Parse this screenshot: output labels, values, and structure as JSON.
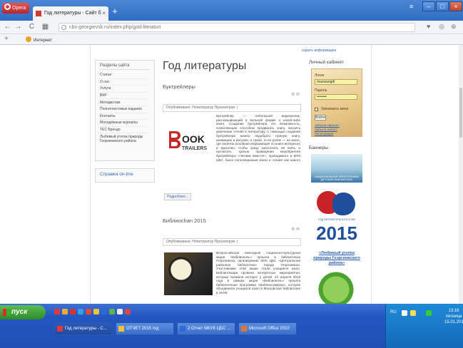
{
  "browser": {
    "menu_label": "Opera",
    "tab_title": "Год литературы - Сайт б",
    "url": "cbs-georgievsk.ru/index.php/god-literaturi",
    "bookmark_label": "Интернет"
  },
  "site": {
    "top_link": "скрыть информацию",
    "sidebar": {
      "title": "Разделы сайта",
      "items": [
        "Статьи",
        "О нас",
        "Услуги",
        "ВКР",
        "Методистам",
        "Полнотекстовые издания",
        "Контакты",
        "Молодёжные журналы",
        "ТЕС Брендо",
        "Любимый уголок природы Георгиевского района"
      ]
    },
    "online_label": "Справка on-line",
    "page_title": "Год литературы",
    "articles": [
      {
        "title": "Буктрейлеры",
        "category": "Опубликовано: Нолитератур  Просмотров: |",
        "logo_top": "OOK",
        "logo_bottom": "TRAILERS",
        "text": "Буктрейлер — небольшой видеоролик, рассказывающий в вольной форме о какой-либо книге. Создание буктрейлера это возможность, позволяющая способом продвигать книгу, вносить увлечение чтения в литературу. С помощью создания буктрейлера можно подобрать нужную книгу, анимацию и рисунки, а также, если ролик — на книге, где понятна основная информация по книге интересно и красочно, чтобы сразу захотелось её взять и прочитать. Целью проведения мероприятия буктрейлеры «Читаем вместе!», проводимого в МУК ЦБС, было популяризация книги и чтения как одного из элементов современной среды проведения библиотеки и активного участия читателей города Георгиевска и Георгиевского района. Реализованы новые форматы общения с читателями библиотек."
      },
      {
        "title": "Библиоchan 2015",
        "category": "Опубликовано: Нолитератур  Просмотров: |",
        "text": "Всероссийская ежегодная социально-культурная акция «Библионочь» прошла в библиотеках Георгиевска, организуемая МУК ЦБС «Центральная районная библиотека» города Георгиевска. Участниками этой акции стали учащиеся школ. Библиотекари провели интересные мероприятия, которые вызвали интерес у детей. 24 апреля 2015 года в рамках акции «Библионочь» прошла библиотечная программа «Библиосумерки», которая объединила учащихся школ в Московской библиотеке в 19:00."
      }
    ],
    "more_label": "Подробнее...",
    "cabinet": {
      "title": "Личный кабинет",
      "login_label": "Логин",
      "login_value": "maxwangdi",
      "password_label": "Пароль",
      "password_value": "••••••••",
      "remember_label": "Запомнить меня",
      "submit_label": "Войти",
      "links": [
        "Забыли пароль?",
        "Забыли логин?",
        "Регистрация"
      ]
    },
    "banners_title": "Баннеры",
    "banner1_caption": "НАЦИОНАЛЬНАЯ ЭЛЕКТРОННАЯ ДЕТСКАЯ БИБЛИОТЕКА",
    "banner2_caption": "ГОД ЛИТЕРАТУРЫ В РОССИИ",
    "banner2_year": "2015",
    "fav_link": "«Любимый уголок природы Георгиевского района»"
  },
  "taskbar": {
    "start_label": "пуск",
    "tasks": [
      "Год литературы - С...",
      "ОТЧЕТ 2015 год",
      "2 Отчет МКУК ЦБС ...",
      "Microsoft Office 2010"
    ],
    "lang": "RU",
    "time": "13:16",
    "weekday": "пятница",
    "date": "15.01.2016"
  },
  "colors": {
    "accent": "#3768b3",
    "taskbar": "#2456c0",
    "title_bar": "#3b7bd0"
  }
}
